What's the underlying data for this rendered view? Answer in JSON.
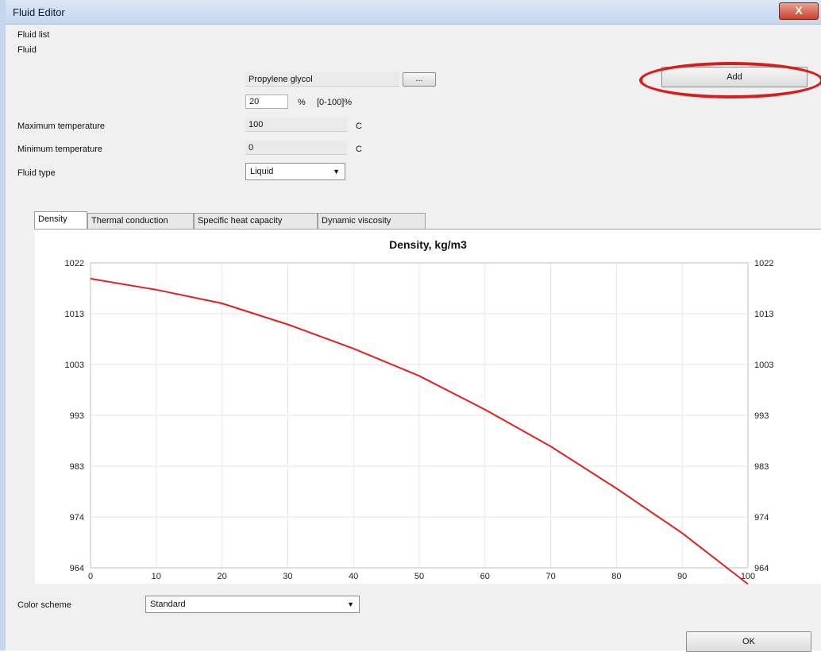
{
  "window": {
    "title": "Fluid Editor",
    "close_label": "X"
  },
  "form": {
    "group_label": "Fluid list",
    "fluid_label": "Fluid",
    "fluid_value": "Propylene glycol",
    "browse_label": "...",
    "percent_value": "20",
    "percent_unit": "%",
    "percent_range": "[0-100]%",
    "max_temp_label": "Maximum temperature",
    "max_temp_value": "100",
    "max_temp_unit": "C",
    "min_temp_label": "Minimum temperature",
    "min_temp_value": "0",
    "min_temp_unit": "C",
    "fluid_type_label": "Fluid type",
    "fluid_type_value": "Liquid",
    "add_label": "Add"
  },
  "tabs": [
    "Density",
    "Thermal conduction",
    "Specific heat capacity",
    "Dynamic viscosity"
  ],
  "chart_data": {
    "type": "line",
    "title": "Density, kg/m3",
    "xlabel": "",
    "ylabel": "",
    "xlim": [
      0,
      100
    ],
    "ylim": [
      964,
      1022
    ],
    "x_ticks": [
      "0",
      "10",
      "20",
      "30",
      "40",
      "50",
      "60",
      "70",
      "80",
      "90",
      "100"
    ],
    "y_ticks": [
      "1022",
      "1013",
      "1003",
      "993",
      "983",
      "974",
      "964"
    ],
    "grid": true,
    "series_color": "#e02020",
    "series": [
      {
        "x": [
          0,
          10,
          20,
          30,
          40,
          50,
          60,
          70,
          80,
          90,
          100
        ],
        "y": [
          1019,
          1016.9,
          1014.3,
          1010.3,
          1005.7,
          1000.5,
          994.1,
          987.1,
          979.1,
          970.6,
          960.9
        ]
      }
    ]
  },
  "footer": {
    "color_scheme_label": "Color scheme",
    "color_scheme_value": "Standard",
    "ok_label": "OK"
  }
}
